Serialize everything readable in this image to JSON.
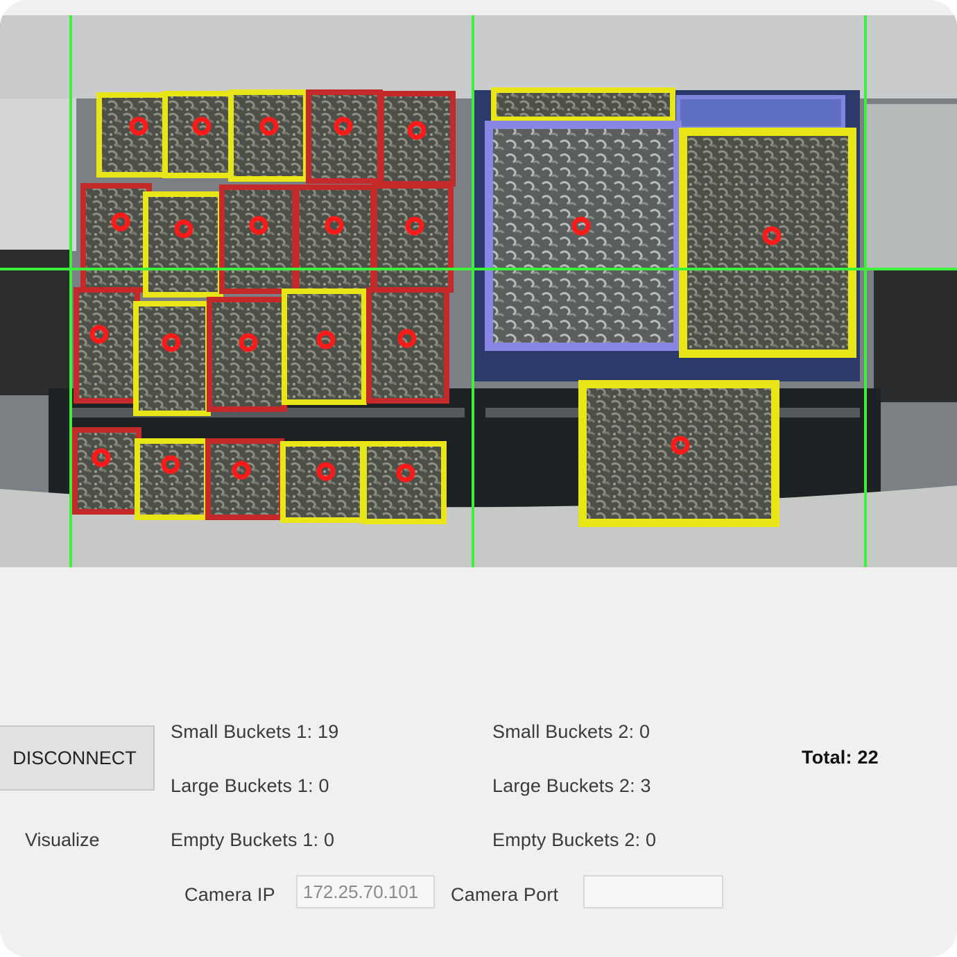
{
  "controls": {
    "disconnect_label": "DISCONNECT",
    "visualize_label": "Visualize"
  },
  "counts": {
    "small_1": {
      "label": "Small Buckets 1:",
      "value": "19"
    },
    "large_1": {
      "label": "Large Buckets 1:",
      "value": "0"
    },
    "empty_1": {
      "label": "Empty Buckets 1:",
      "value": "0"
    },
    "small_2": {
      "label": "Small Buckets 2:",
      "value": "0"
    },
    "large_2": {
      "label": "Large Buckets 2:",
      "value": "3"
    },
    "empty_2": {
      "label": "Empty Buckets 2:",
      "value": "0"
    },
    "total": {
      "label": "Total:",
      "value": "22"
    }
  },
  "camera": {
    "ip_label": "Camera IP",
    "ip_value": "172.25.70.101",
    "port_label": "Camera Port",
    "port_value": ""
  },
  "colors": {
    "grid_line": "#3cf03c",
    "small_bucket_yellow": "#e8e617",
    "small_bucket_red": "#c42a2a",
    "large_bucket_blue": "#8a86e6",
    "detection_marker": "#ff1a1a"
  },
  "detections": {
    "marker_icon": "detection-center-icon",
    "bucket_types": [
      "yellow",
      "red",
      "blue"
    ]
  }
}
